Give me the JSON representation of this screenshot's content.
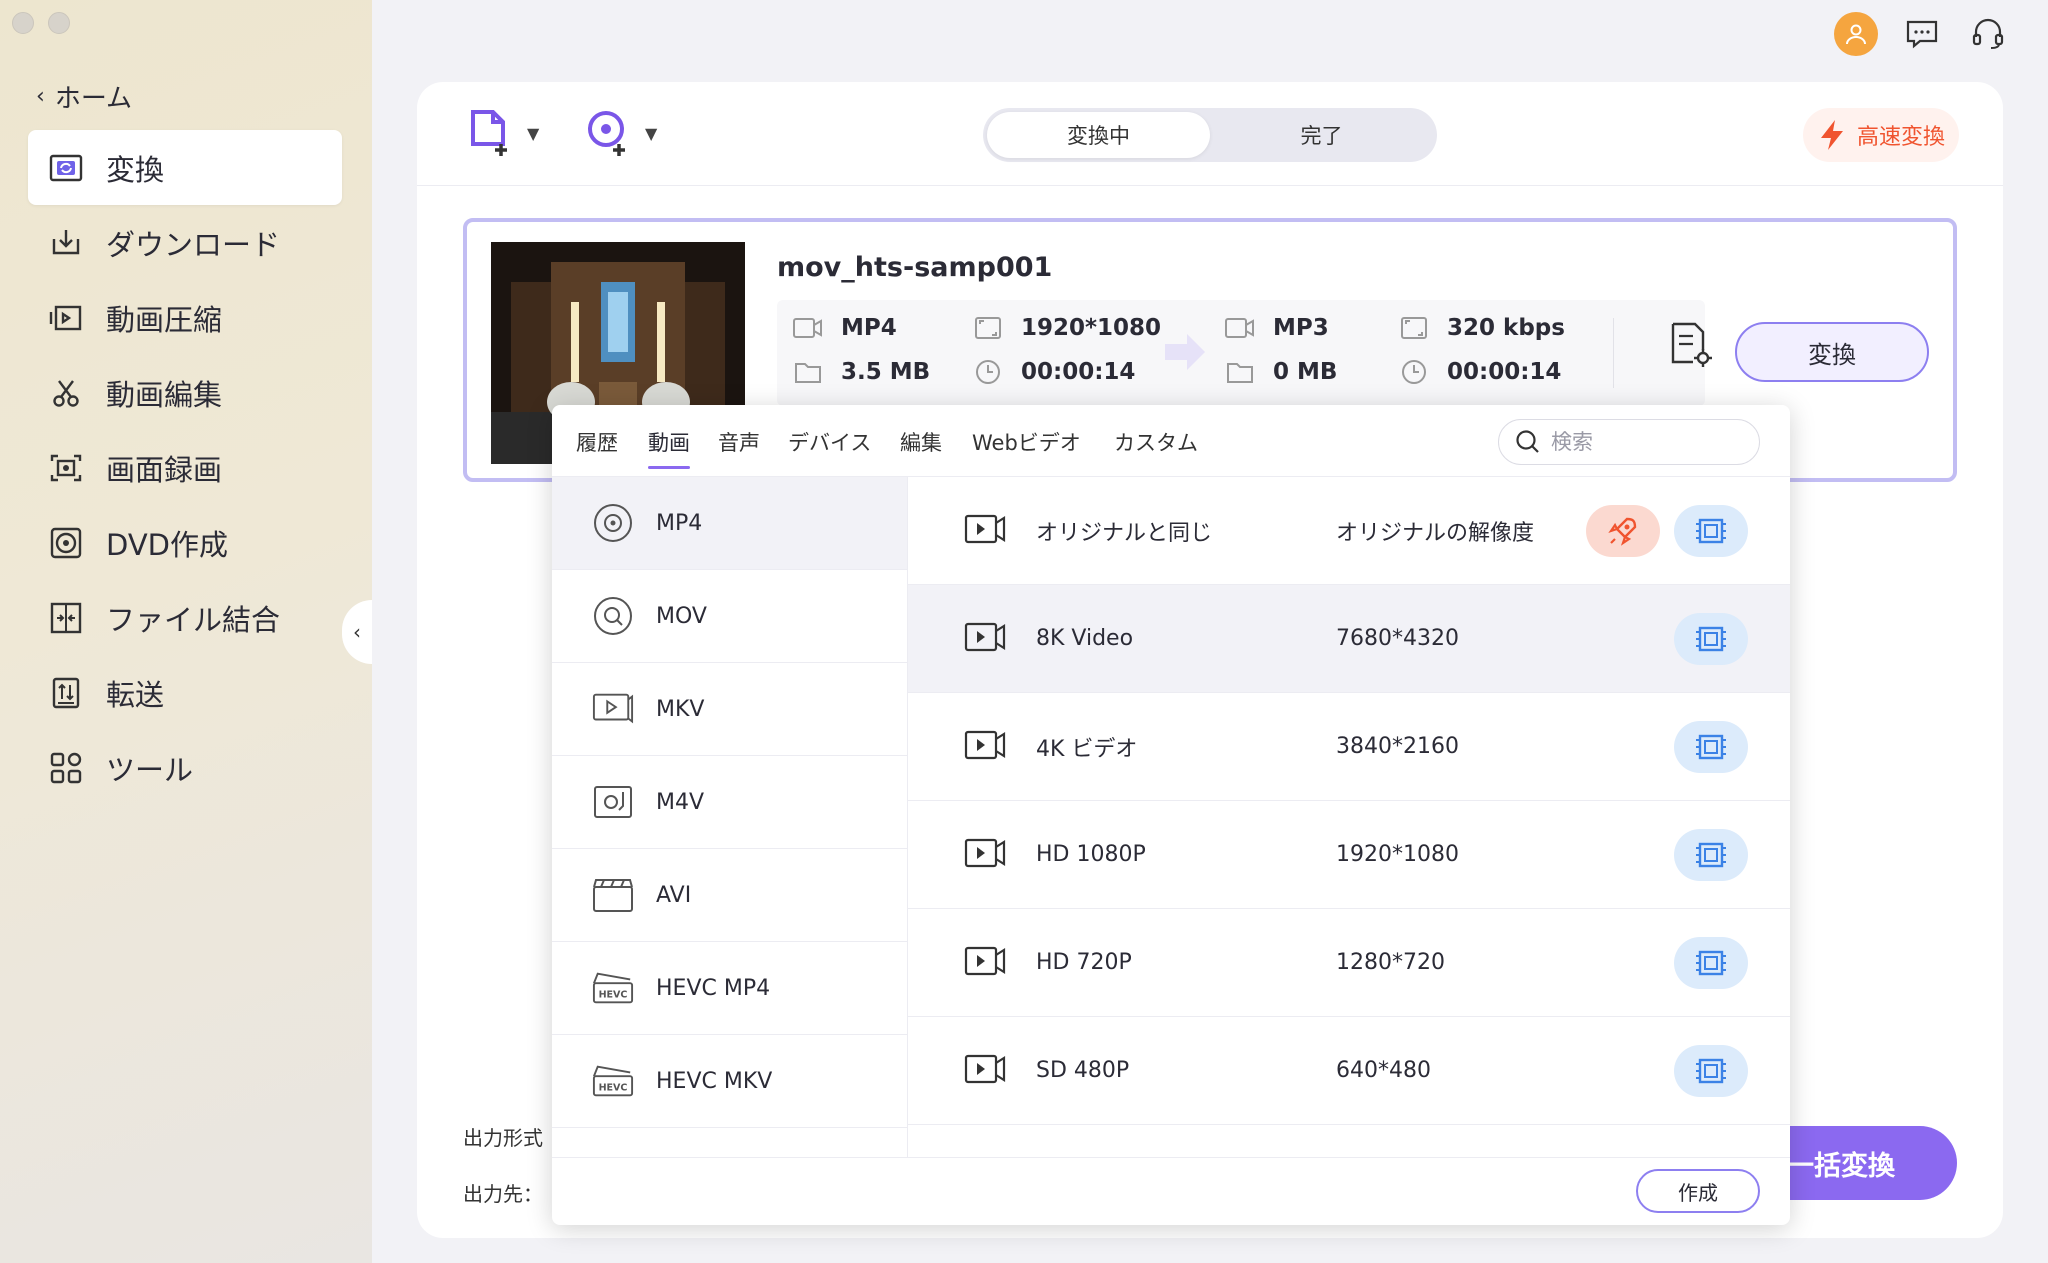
{
  "sidebar": {
    "home_label": "ホーム",
    "items": [
      {
        "label": "変換",
        "icon": "convert-icon",
        "active": true
      },
      {
        "label": "ダウンロード",
        "icon": "download-icon",
        "active": false
      },
      {
        "label": "動画圧縮",
        "icon": "compress-icon",
        "active": false
      },
      {
        "label": "動画編集",
        "icon": "scissors-icon",
        "active": false
      },
      {
        "label": "画面録画",
        "icon": "screen-record-icon",
        "active": false
      },
      {
        "label": "DVD作成",
        "icon": "dvd-icon",
        "active": false
      },
      {
        "label": "ファイル結合",
        "icon": "merge-icon",
        "active": false
      },
      {
        "label": "転送",
        "icon": "transfer-icon",
        "active": false
      },
      {
        "label": "ツール",
        "icon": "tools-icon",
        "active": false
      }
    ]
  },
  "toolbar": {
    "tabs": [
      "変換中",
      "完了"
    ],
    "active_tab": "変換中",
    "fast_convert_label": "高速変換"
  },
  "file": {
    "name": "mov_hts-samp001",
    "source": {
      "format": "MP4",
      "size": "3.5 MB",
      "resolution": "1920*1080",
      "duration": "00:00:14"
    },
    "target": {
      "format": "MP3",
      "size": "0 MB",
      "bitrate": "320 kbps",
      "duration": "00:00:14"
    },
    "convert_label": "変換"
  },
  "footer": {
    "output_format_label": "出力形式",
    "output_dest_label": "出力先：",
    "batch_convert_label": "一括変換"
  },
  "dropdown": {
    "tabs": [
      "履歴",
      "動画",
      "音声",
      "デバイス",
      "編集",
      "Webビデオ",
      "カスタム"
    ],
    "active_tab": "動画",
    "search_placeholder": "検索",
    "formats": [
      {
        "label": "MP4",
        "icon": "mp4-icon"
      },
      {
        "label": "MOV",
        "icon": "mov-icon"
      },
      {
        "label": "MKV",
        "icon": "mkv-icon"
      },
      {
        "label": "M4V",
        "icon": "m4v-icon"
      },
      {
        "label": "AVI",
        "icon": "avi-icon"
      },
      {
        "label": "HEVC MP4",
        "icon": "hevc-icon"
      },
      {
        "label": "HEVC MKV",
        "icon": "hevc-icon"
      }
    ],
    "active_format": "MP4",
    "presets": [
      {
        "name": "オリジナルと同じ",
        "resolution": "オリジナルの解像度",
        "boost": true
      },
      {
        "name": "8K Video",
        "resolution": "7680*4320",
        "boost": false
      },
      {
        "name": "4K ビデオ",
        "resolution": "3840*2160",
        "boost": false
      },
      {
        "name": "HD 1080P",
        "resolution": "1920*1080",
        "boost": false
      },
      {
        "name": "HD 720P",
        "resolution": "1280*720",
        "boost": false
      },
      {
        "name": "SD 480P",
        "resolution": "640*480",
        "boost": false
      }
    ],
    "create_label": "作成"
  },
  "colors": {
    "accent": "#8b69f0",
    "fast": "#f0542f",
    "avatar": "#f5a53f"
  }
}
